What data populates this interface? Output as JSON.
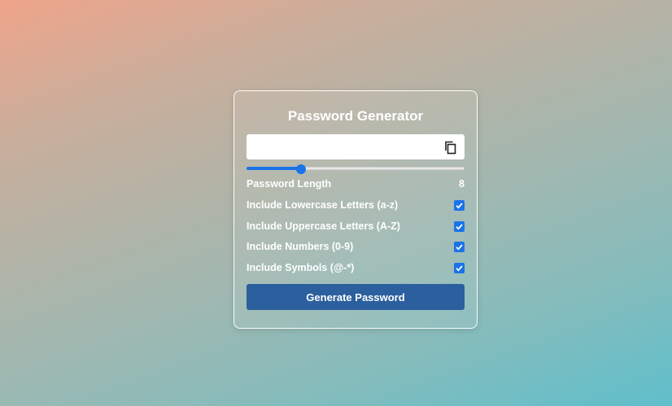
{
  "app": {
    "title": "Password Generator"
  },
  "password": {
    "value": "",
    "copy_icon": "copy-icon"
  },
  "length": {
    "label": "Password Length",
    "value": "8",
    "slider_fraction": 0.25
  },
  "options": [
    {
      "label": "Include Lowercase Letters (a-z)",
      "checked": true
    },
    {
      "label": "Include Uppercase Letters (A-Z)",
      "checked": true
    },
    {
      "label": "Include Numbers (0-9)",
      "checked": true
    },
    {
      "label": "Include Symbols (@-*)",
      "checked": true
    }
  ],
  "actions": {
    "generate_label": "Generate Password"
  },
  "colors": {
    "accent": "#1a73e8",
    "button": "#2c5f9e"
  }
}
